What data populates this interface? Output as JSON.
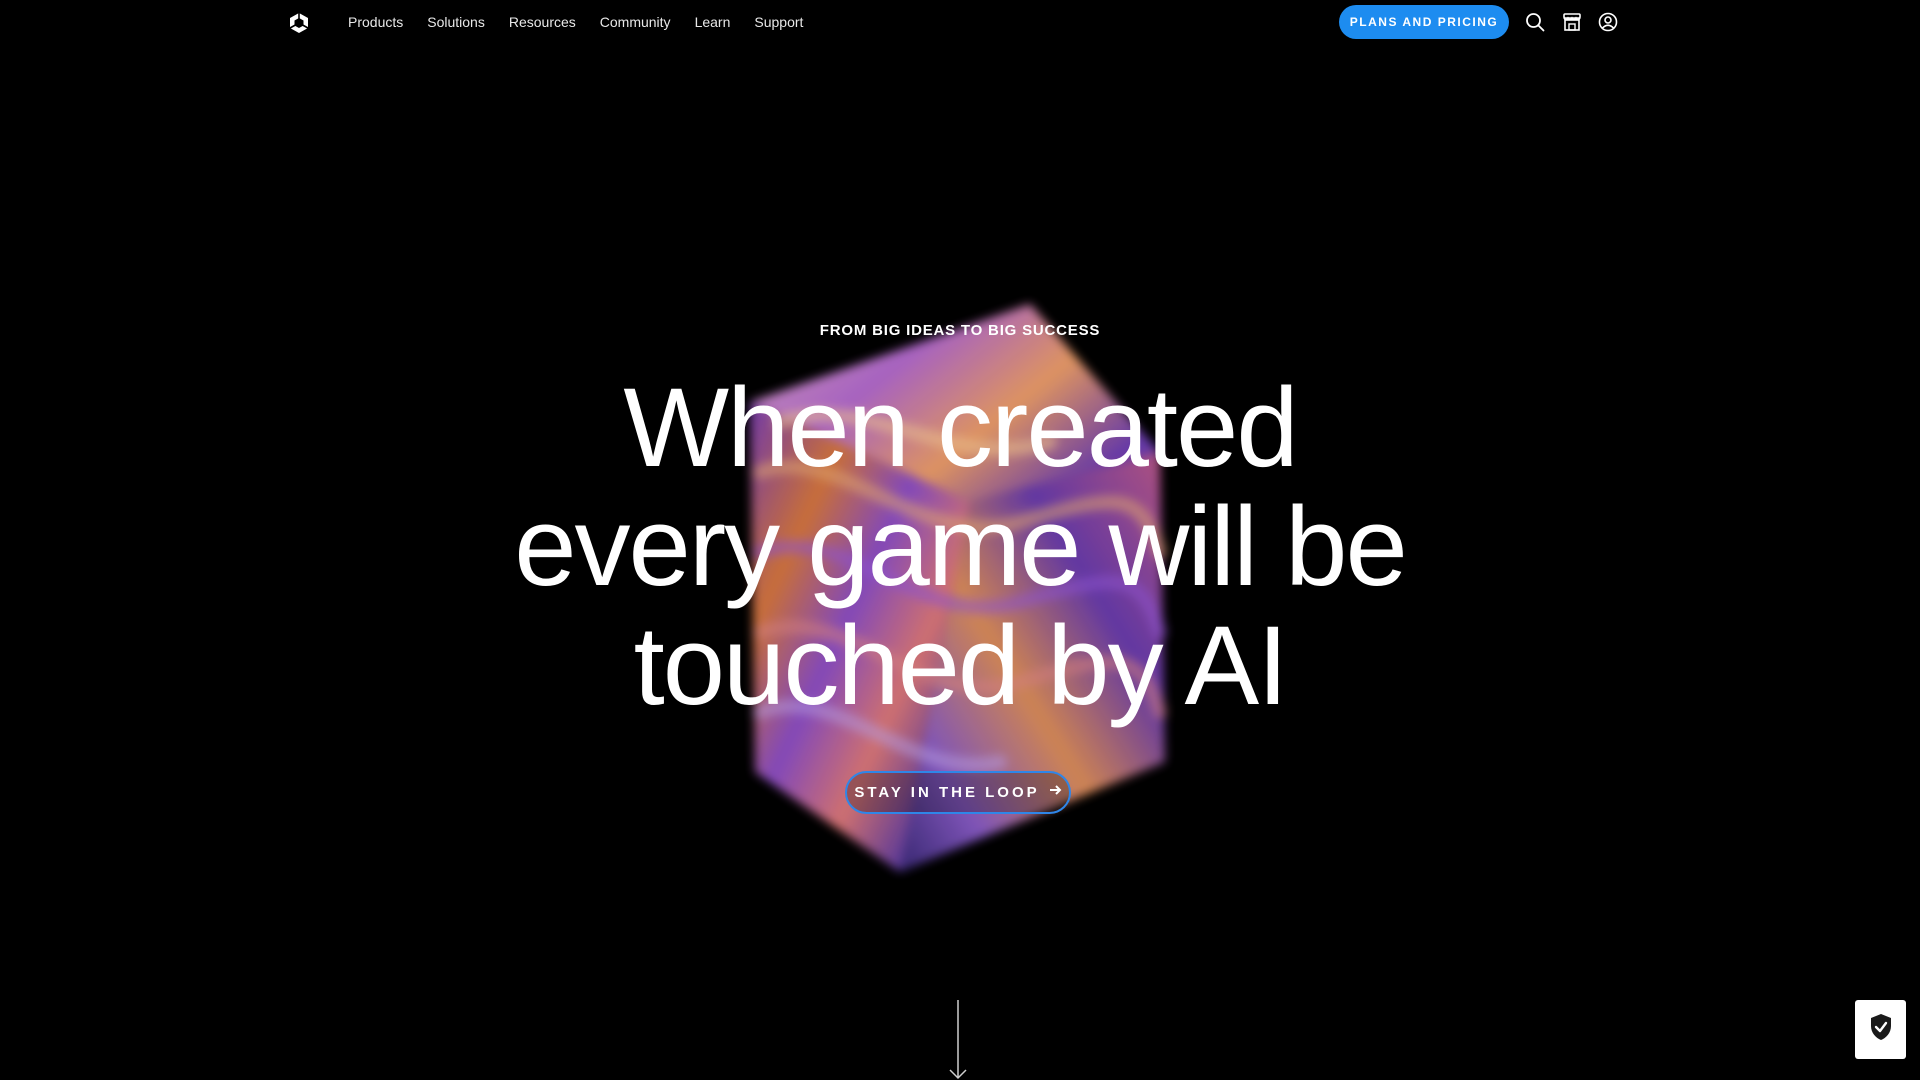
{
  "nav": {
    "logo": "unity-logo-icon",
    "links": [
      "Products",
      "Solutions",
      "Resources",
      "Community",
      "Learn",
      "Support"
    ],
    "pricing_label": "PLANS AND PRICING",
    "icons": [
      "search-icon",
      "store-icon",
      "account-icon"
    ]
  },
  "hero": {
    "eyebrow": "FROM BIG IDEAS TO BIG SUCCESS",
    "headline_lines": [
      "When created",
      "every game will be",
      "touched by AI"
    ],
    "cta_label": "STAY IN THE LOOP",
    "cta_icon": "arrow-right-icon"
  },
  "footer_widgets": {
    "scroll_icon": "arrow-down-icon",
    "privacy_icon": "shield-check-icon"
  },
  "colors": {
    "background": "#000000",
    "accent": "#1d8cf0",
    "cta_border": "#2f86e8",
    "text": "#ffffff"
  }
}
